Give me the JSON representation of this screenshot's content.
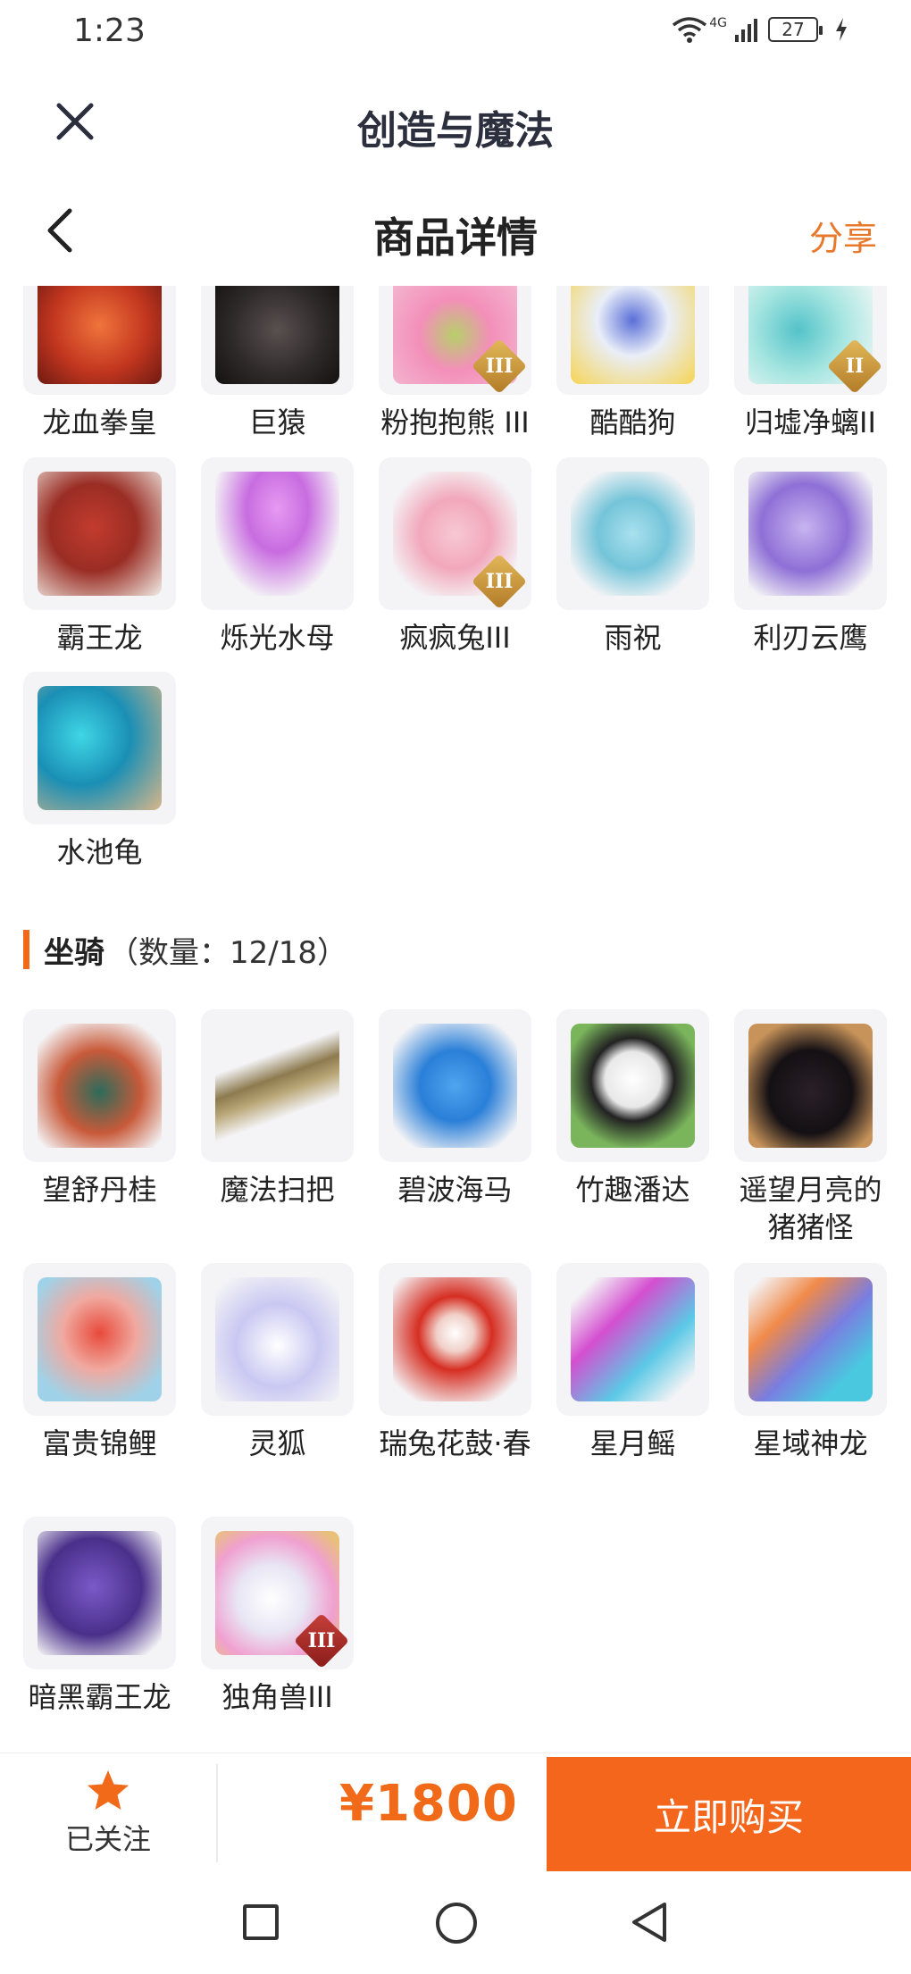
{
  "status": {
    "time": "1:23",
    "network": "4G",
    "battery": "27"
  },
  "app": {
    "title": "创造与魔法",
    "close_icon": "close-icon"
  },
  "nav": {
    "title": "商品详情",
    "share": "分享",
    "back_icon": "chevron-left-icon"
  },
  "colors": {
    "accent": "#f4661b",
    "price": "#f06a1a",
    "title": "#2b2f3e"
  },
  "pets": {
    "top_row": [
      {
        "name": "龙血拳皇",
        "badge": ""
      },
      {
        "name": "巨猿",
        "badge": ""
      },
      {
        "name": "粉抱抱熊 III",
        "badge": "III"
      },
      {
        "name": "酷酷狗",
        "badge": ""
      },
      {
        "name": "归墟净螭II",
        "badge": "II"
      }
    ],
    "row2": [
      {
        "name": "霸王龙",
        "badge": ""
      },
      {
        "name": "烁光水母",
        "badge": ""
      },
      {
        "name": "疯疯兔III",
        "badge": "III"
      },
      {
        "name": "雨祝",
        "badge": ""
      },
      {
        "name": "利刃云鹰",
        "badge": ""
      }
    ],
    "row3": [
      {
        "name": "水池龟",
        "badge": ""
      }
    ]
  },
  "mounts": {
    "title": "坐骑",
    "count": "（数量：12/18）",
    "row1": [
      {
        "name": "望舒丹桂",
        "badge": ""
      },
      {
        "name": "魔法扫把",
        "badge": ""
      },
      {
        "name": "碧波海马",
        "badge": ""
      },
      {
        "name": "竹趣潘达",
        "badge": ""
      },
      {
        "name": "遥望月亮的猪猪怪",
        "badge": ""
      }
    ],
    "row2": [
      {
        "name": "富贵锦鲤",
        "badge": ""
      },
      {
        "name": "灵狐",
        "badge": ""
      },
      {
        "name": "瑞兔花鼓·春",
        "badge": ""
      },
      {
        "name": "星月鳐",
        "badge": ""
      },
      {
        "name": "星域神龙",
        "badge": ""
      }
    ],
    "row3": [
      {
        "name": "暗黑霸王龙",
        "badge": ""
      },
      {
        "name": "独角兽III",
        "badge": "III"
      }
    ]
  },
  "bottom": {
    "follow_label": "已关注",
    "price": "¥1800",
    "buy_label": "立即购买"
  }
}
